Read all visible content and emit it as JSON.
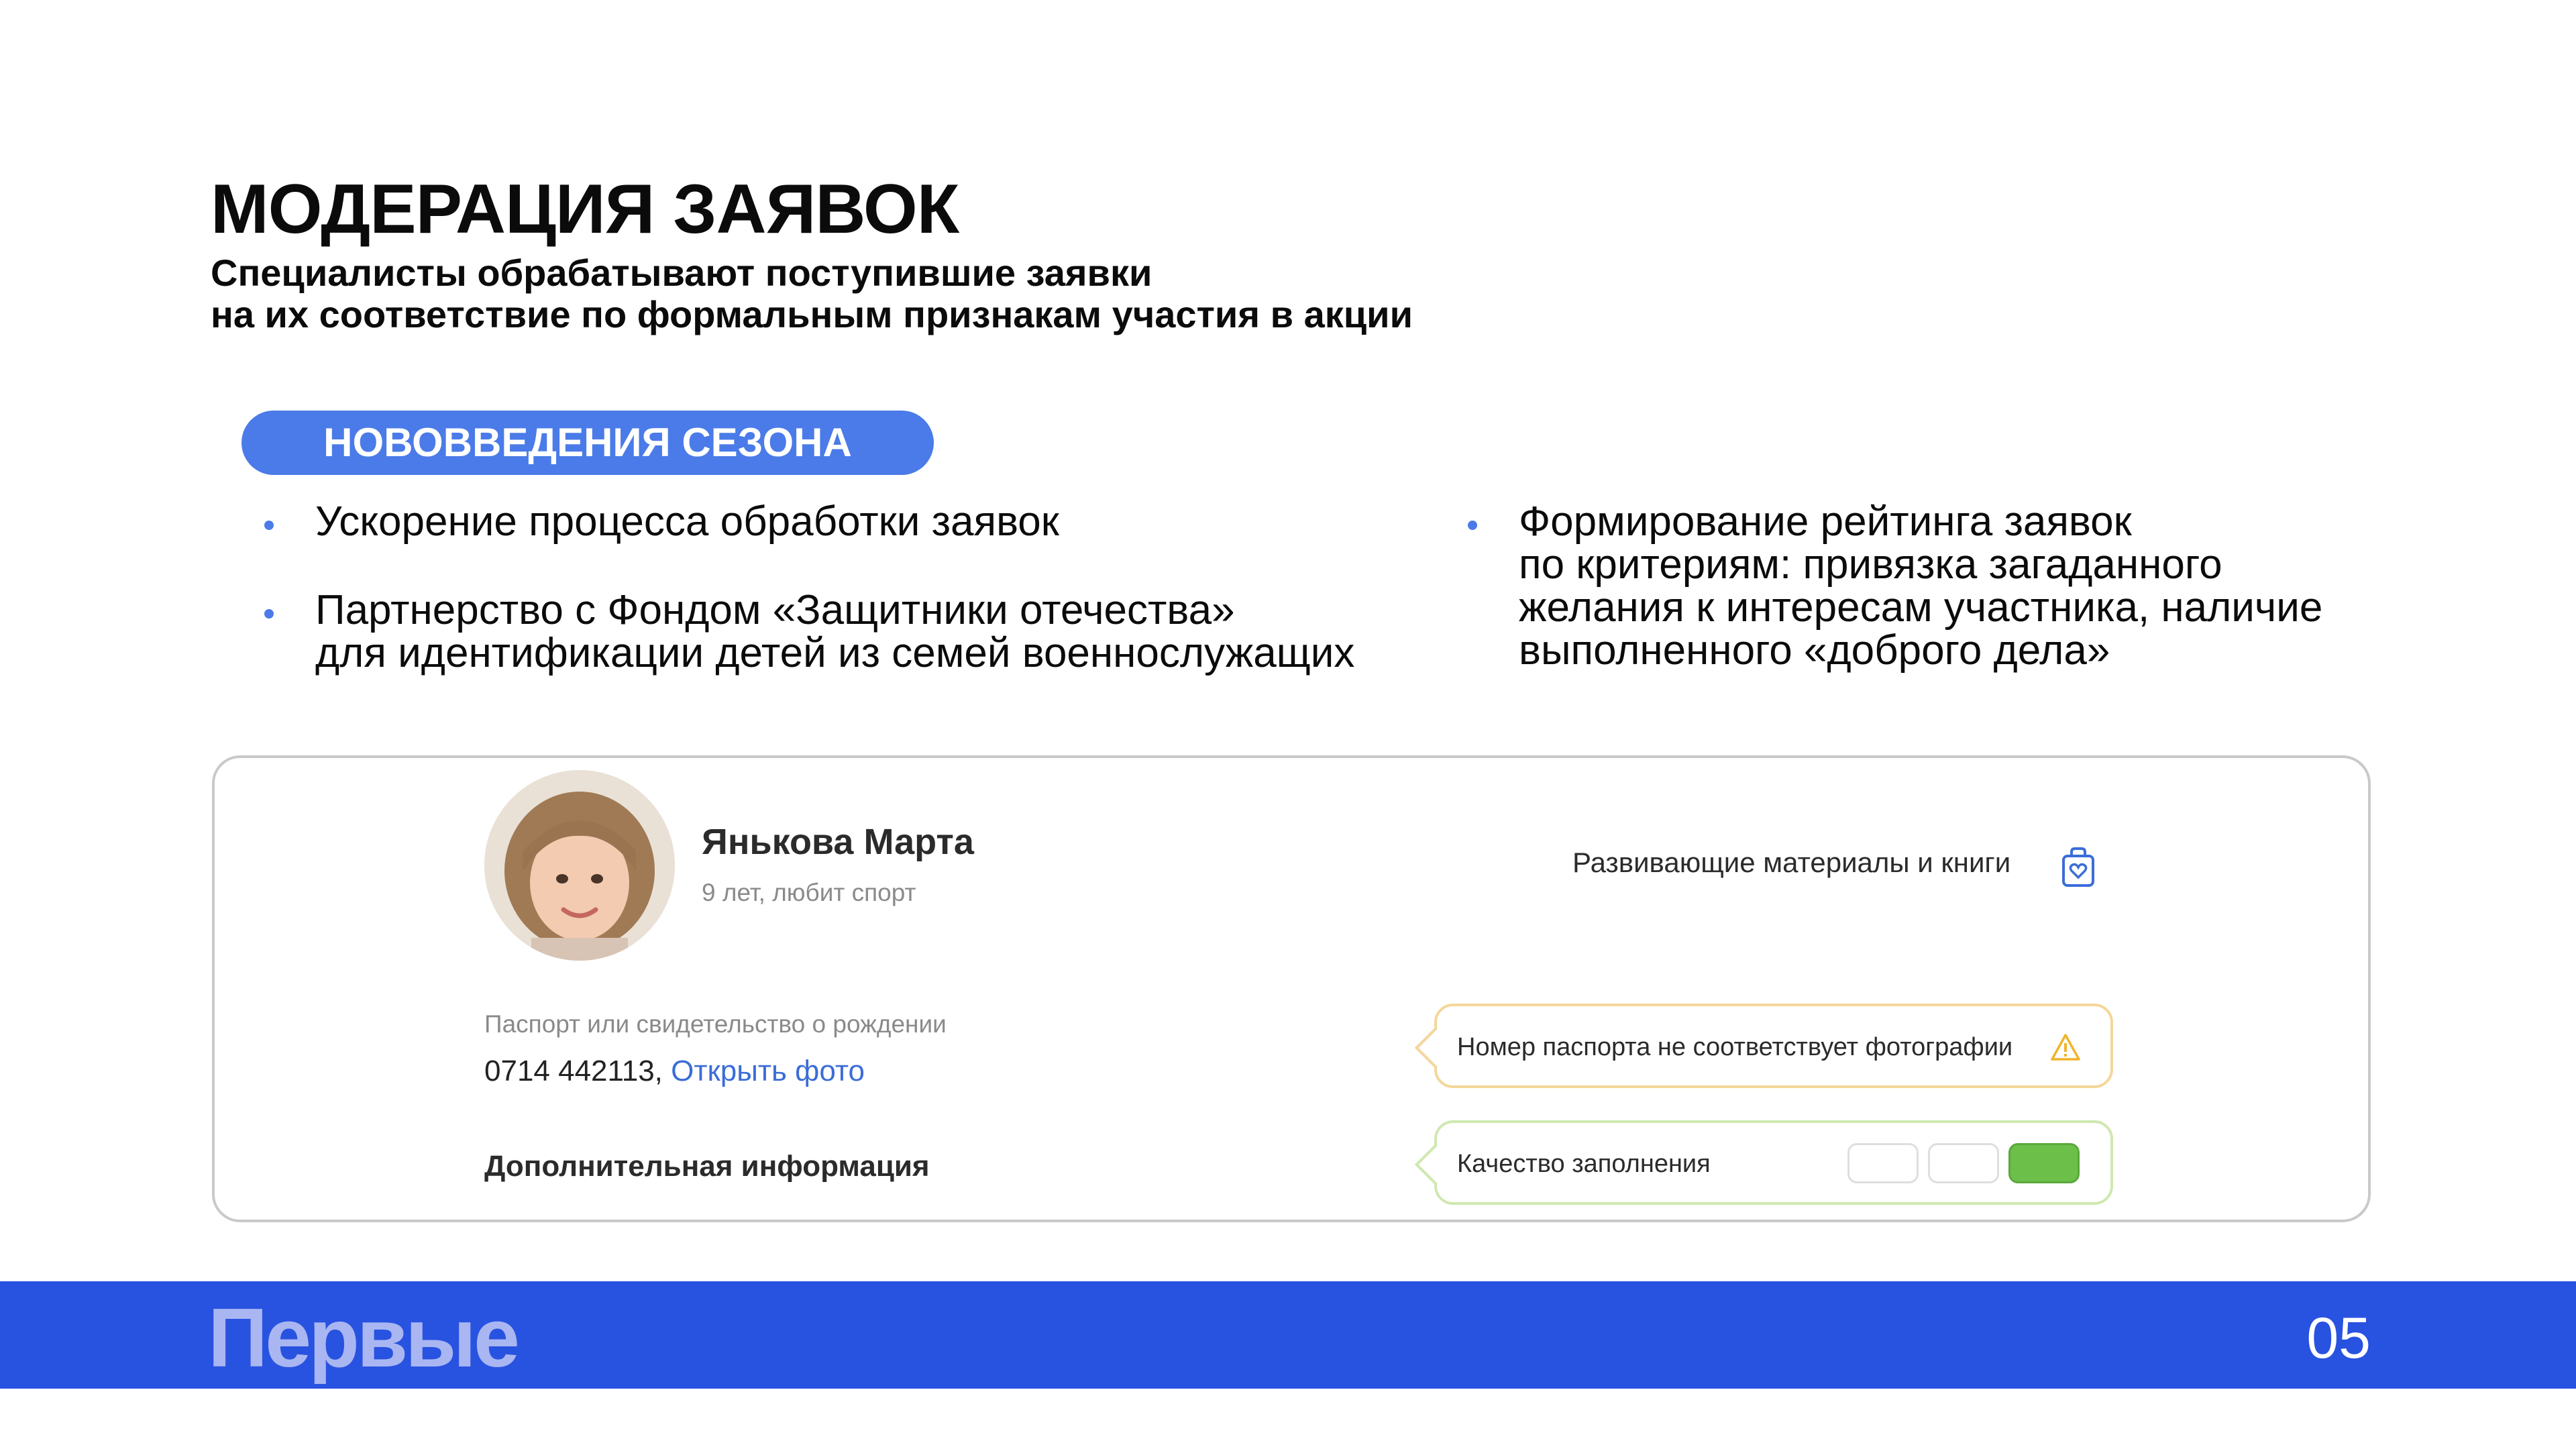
{
  "title": "МОДЕРАЦИЯ ЗАЯВОК",
  "subtitle": {
    "line1": "Специалисты обрабатывают поступившие заявки",
    "line2": "на их соответствие по формальным признакам участия в акции"
  },
  "badge": "НОВОВВЕДЕНИЯ СЕЗОНА",
  "bullets_left": [
    {
      "line1": "Ускорение процесса обработки заявок"
    },
    {
      "line1": "Партнерство с Фондом «Защитники отечества»",
      "line2": "для идентификации детей из семей военнослужащих"
    }
  ],
  "bullets_right": [
    {
      "line1": "Формирование рейтинга заявок",
      "line2": "по критериям: привязка загаданного",
      "line3": "желания к интересам участника, наличие",
      "line4": "выполненного «доброго дела»"
    }
  ],
  "card": {
    "child_name": "Янькова Марта",
    "child_desc": "9 лет, любит спорт",
    "doc_label": "Паспорт или свидетельство о рождении",
    "doc_number": "0714 442113,",
    "doc_link": "Открыть фото",
    "extra_info": "Дополнительная информация",
    "gift": "Развивающие материалы и книги",
    "gift_icon": "gift-bag-icon",
    "warning_text": "Номер паспорта не соответствует фотографии",
    "warning_icon": "warning-triangle-icon",
    "quality_label": "Качество заполнения",
    "quality_level": {
      "filled": 1,
      "total": 3
    }
  },
  "footer": {
    "brand": "Первые",
    "page": "05"
  },
  "colors": {
    "accent": "#4a7be8",
    "footer": "#2852e0",
    "warning_border": "#f3d79a",
    "quality_border": "#cfe8b0",
    "quality_fill": "#6cc04a",
    "link": "#3b6dd8"
  }
}
